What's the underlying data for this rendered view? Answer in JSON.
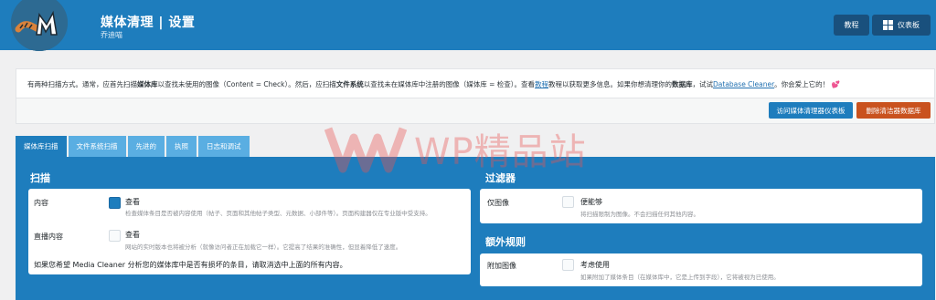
{
  "header": {
    "title": "媒体清理 | 设置",
    "subtitle": "乔迪喵",
    "tutorial_btn": "教程",
    "dashboard_btn": "仪表板"
  },
  "notice": {
    "p1": "有两种扫描方式。通常，应首先扫描",
    "b1": "媒体库",
    "p2": "以查找未使用的图像（Content = Check）。然后，应扫描",
    "b2": "文件系统",
    "p3": "以查找未在媒体库中注册的图像（媒体库 = 检查）。查看",
    "link1": "教程",
    "p4": "教程以获取更多信息。如果你想清理你的",
    "b3": "数据库",
    "p5": "，试试",
    "link2": "Database Cleaner",
    "p6": "。你会爱上它的！",
    "heart": "💕"
  },
  "actions": {
    "visit": "访问媒体清理器仪表板",
    "delete": "删除清洁器数据库"
  },
  "tabs": [
    {
      "label": "媒体库扫描"
    },
    {
      "label": "文件系统扫描"
    },
    {
      "label": "先进的"
    },
    {
      "label": "执照"
    },
    {
      "label": "日志和调试"
    }
  ],
  "scan": {
    "title": "扫描",
    "content_label": "内容",
    "content_check": "查看",
    "content_desc": "检查媒体条目是否被内容使用（帖子、页面和其他帖子类型、元数据、小部件等）。页面构建器仅在专业版中受支持。",
    "live_label": "直播内容",
    "live_check": "查看",
    "live_desc": "网站的实时版本也将被分析（就像访问者正在加载它一样）。它提高了结果的准确性，但显着降低了速度。",
    "note": "如果您希望 Media Cleaner 分析您的媒体库中是否有损坏的条目，请取消选中上面的所有内容。"
  },
  "filters": {
    "title": "过滤器",
    "images_label": "仅图像",
    "images_check": "便能够",
    "images_desc": "将扫描限制为图像。不会扫描任何其他内容。"
  },
  "rules": {
    "title": "额外规则",
    "attached_label": "附加图像",
    "attached_check": "考虑使用",
    "attached_desc": "如果附加了媒体条目（在媒体库中，它是上传到字段），它将被视为已使用。"
  },
  "watermark": "WP精品站",
  "colors": {
    "primary": "#1e7dbd",
    "header_btn": "#19507d",
    "danger": "#c9521e",
    "tab_inactive": "#5aaee2"
  }
}
